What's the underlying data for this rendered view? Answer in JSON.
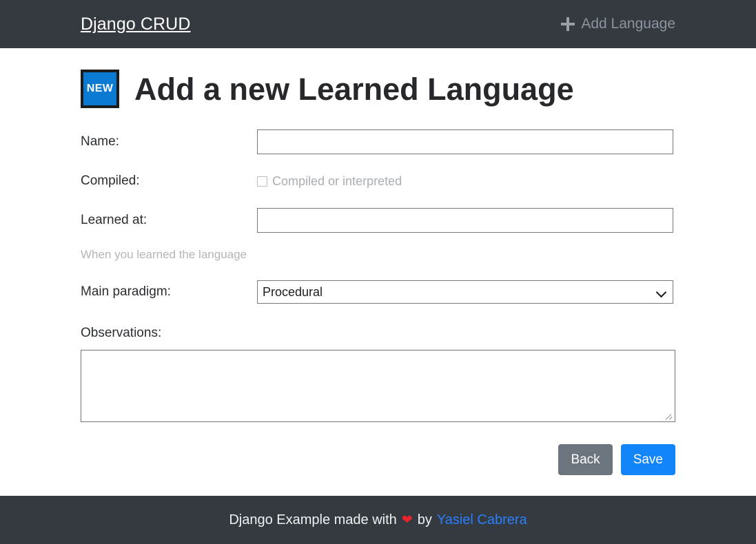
{
  "navbar": {
    "brand": "Django CRUD",
    "add_icon": "plus-icon",
    "add_link_label": "Add Language"
  },
  "page": {
    "badge_label": "NEW",
    "title": "Add a new Learned Language"
  },
  "form": {
    "name": {
      "label": "Name:",
      "value": "",
      "placeholder": ""
    },
    "compiled": {
      "label": "Compiled:",
      "checkbox_caption": "Compiled or interpreted",
      "checked": false
    },
    "learned_at": {
      "label": "Learned at:",
      "value": "",
      "placeholder": "",
      "help_text": "When you learned the language"
    },
    "paradigm": {
      "label": "Main paradigm:",
      "selected": "Procedural",
      "chevron_icon": "chevron-down-icon"
    },
    "observations": {
      "label": "Observations:",
      "value": "",
      "placeholder": ""
    },
    "buttons": {
      "back": "Back",
      "save": "Save"
    }
  },
  "footer": {
    "text_before": "Django Example made with",
    "heart_icon": "❤",
    "text_middle": "by",
    "author_link": "Yasiel Cabrera"
  },
  "colors": {
    "navbar_bg": "#343a40",
    "badge_blue": "#0b7ad3",
    "save_blue": "#1285fb",
    "back_gray": "#6c757d",
    "link_blue": "#2a7ffb",
    "heart_red": "#e8252a"
  }
}
